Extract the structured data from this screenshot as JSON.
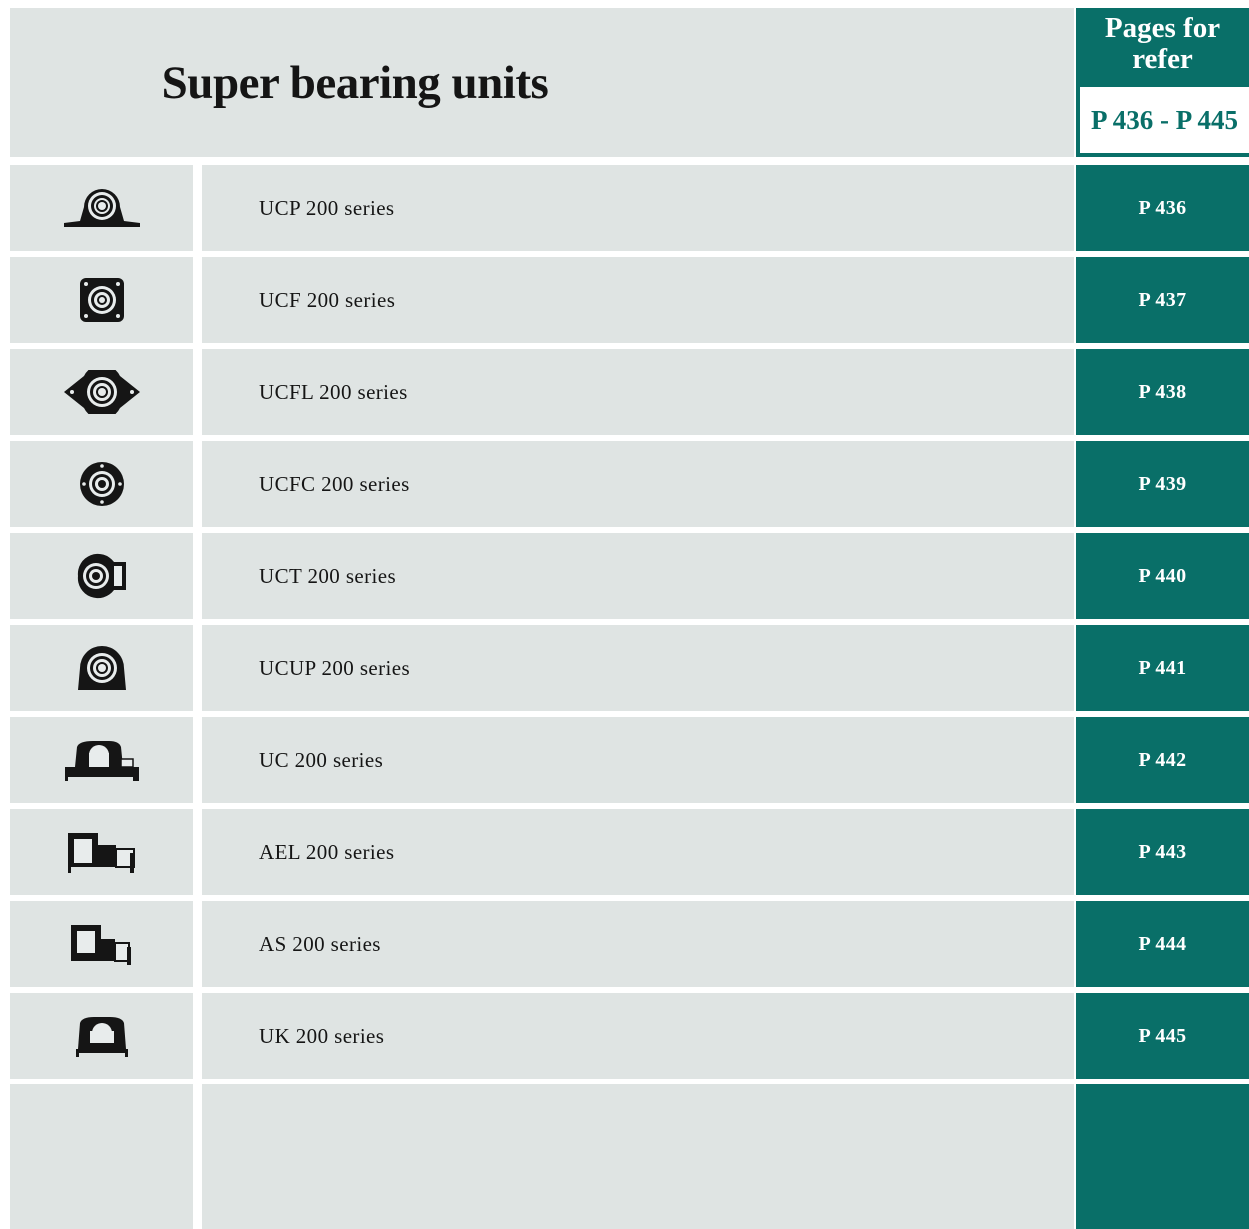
{
  "header": {
    "title": "Super bearing units",
    "pages_label": "Pages for refer",
    "page_range": "P 436 - P 445"
  },
  "rows": [
    {
      "name": "UCP 200 series",
      "page": "P 436",
      "icon": "pillow-block-icon"
    },
    {
      "name": "UCF 200 series",
      "page": "P 437",
      "icon": "square-flange-icon"
    },
    {
      "name": "UCFL 200 series",
      "page": "P 438",
      "icon": "oval-flange-icon"
    },
    {
      "name": "UCFC 200 series",
      "page": "P 439",
      "icon": "round-flange-icon"
    },
    {
      "name": "UCT 200 series",
      "page": "P 440",
      "icon": "take-up-unit-icon"
    },
    {
      "name": "UCUP 200 series",
      "page": "P 441",
      "icon": "tapped-base-pillow-icon"
    },
    {
      "name": "UC 200 series",
      "page": "P 442",
      "icon": "insert-bearing-icon"
    },
    {
      "name": "AEL 200 series",
      "page": "P 443",
      "icon": "eccentric-collar-bearing-icon"
    },
    {
      "name": "AS 200 series",
      "page": "P 444",
      "icon": "setscrew-bearing-icon"
    },
    {
      "name": "UK 200 series",
      "page": "P 445",
      "icon": "adapter-sleeve-bearing-icon"
    }
  ],
  "colors": {
    "teal": "#096f68",
    "panel": "#dfe4e3",
    "text": "#151515"
  }
}
